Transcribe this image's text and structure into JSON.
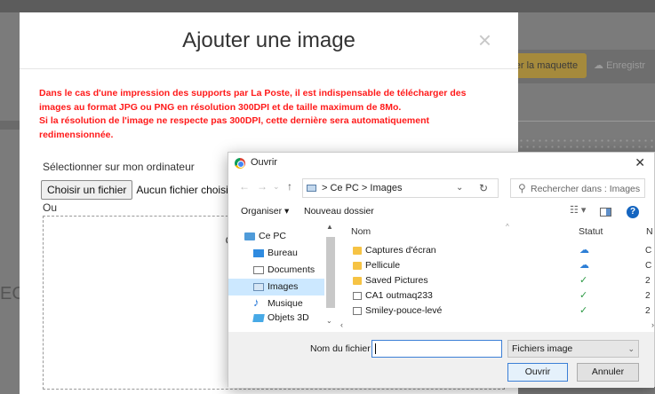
{
  "background": {
    "button_load_model": "rger la maquette",
    "button_save": "Enregistr"
  },
  "modal": {
    "title": "Ajouter une image",
    "close": "×",
    "warning_lines": [
      "Dans le cas d'une impression des supports par La Poste, il est indispensable de télécharger des",
      "images au format JPG ou PNG en résolution 300DPI et de taille maximum de 8Mo.",
      "Si la résolution de l'image ne respecte pas 300DPI, cette dernière sera automatiquement",
      "redimensionnée."
    ],
    "select_label": "Sélectionner sur mon ordinateur",
    "choose_file_button": "Choisir un fichier",
    "no_file_text": "Aucun fichier choisi",
    "or_label": "Ou",
    "dropzone_text": "Glissez-Déposez u"
  },
  "dialog": {
    "title": "Ouvrir",
    "close": "✕",
    "address": {
      "crumbs": "> Ce PC  >  Images",
      "dropdown": "⌄",
      "refresh": "↻"
    },
    "search_placeholder": "Rechercher dans : Images",
    "toolbar": {
      "organize": "Organiser ▾",
      "new_folder": "Nouveau dossier",
      "view": "☷ ▾",
      "help": "?"
    },
    "nav_items": [
      {
        "label": "Ce PC",
        "icon": "computer-icon"
      },
      {
        "label": "Bureau",
        "icon": "desktop-icon"
      },
      {
        "label": "Documents",
        "icon": "documents-icon"
      },
      {
        "label": "Images",
        "icon": "images-icon",
        "selected": true
      },
      {
        "label": "Musique",
        "icon": "music-icon"
      },
      {
        "label": "Objets 3D",
        "icon": "objects-3d-icon"
      }
    ],
    "columns": {
      "name": "Nom",
      "status": "Statut"
    },
    "files": [
      {
        "name": "Captures d'écran",
        "type": "folder",
        "status": "cloud",
        "glyph": "☁",
        "cut": "C"
      },
      {
        "name": "Pellicule",
        "type": "folder",
        "status": "cloud",
        "glyph": "☁",
        "cut": "C"
      },
      {
        "name": "Saved Pictures",
        "type": "folder",
        "status": "synced",
        "glyph": "✓",
        "cut": "2"
      },
      {
        "name": "CA1 outmaq233",
        "type": "file",
        "status": "synced",
        "glyph": "✓",
        "cut": "2"
      },
      {
        "name": "Smiley-pouce-levé",
        "type": "file",
        "status": "synced",
        "glyph": "✓",
        "cut": "2"
      }
    ],
    "footer": {
      "filename_label": "Nom du fichier :",
      "filename_value": "",
      "filetype": "Fichiers image",
      "open_button": "Ouvrir",
      "cancel_button": "Annuler"
    }
  },
  "colors": {
    "warning": "#ff1a1a",
    "selected_nav": "#cce8ff",
    "folder": "#f6c344",
    "accent": "#3c7fd6"
  }
}
